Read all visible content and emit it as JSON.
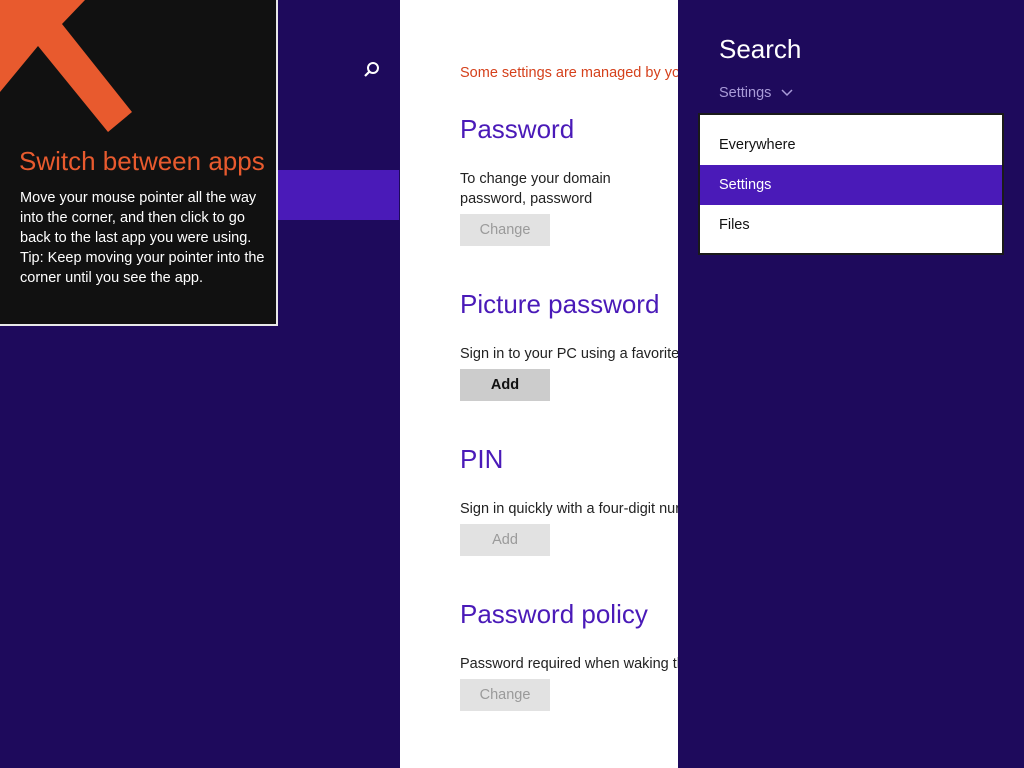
{
  "tip": {
    "title": "Switch between apps",
    "body_1": "Move your mouse pointer all the way into the corner, and then click to go back to the last app you were using.",
    "body_2": "Tip: Keep moving your pointer into the corner until you see the app."
  },
  "content": {
    "managed_notice": "Some settings are managed by yo",
    "sections": [
      {
        "title": "Password",
        "desc": "To change your domain password, password",
        "button": "Change",
        "button_enabled": false
      },
      {
        "title": "Picture password",
        "desc": "Sign in to your PC using a favorite",
        "button": "Add",
        "button_enabled": true
      },
      {
        "title": "PIN",
        "desc": "Sign in quickly with a four-digit nur",
        "button": "Add",
        "button_enabled": false
      },
      {
        "title": "Password policy",
        "desc": "Password required when waking th",
        "button": "Change",
        "button_enabled": false
      }
    ]
  },
  "charm": {
    "title": "Search",
    "scope_label": "Settings",
    "menu": [
      {
        "label": "Everywhere",
        "selected": false
      },
      {
        "label": "Settings",
        "selected": true
      },
      {
        "label": "Files",
        "selected": false
      }
    ]
  },
  "colors": {
    "background": "#1e0a5c",
    "accent": "#4a1ab8",
    "tip_orange": "#e85a2e",
    "notice_red": "#d5411c"
  },
  "icons": [
    "search-icon",
    "corner-arrow-icon",
    "chevron-down-icon"
  ]
}
